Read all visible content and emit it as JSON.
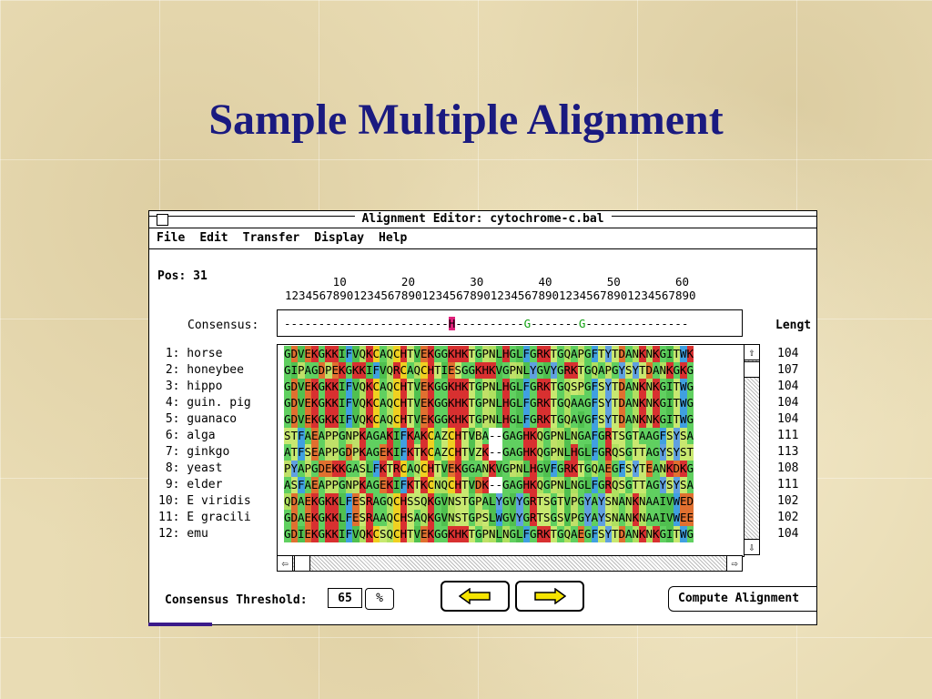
{
  "slide": {
    "title": "Sample Multiple Alignment"
  },
  "window": {
    "title": "Alignment Editor: cytochrome-c.bal",
    "menu": [
      "File",
      "Edit",
      "Transfer",
      "Display",
      "Help"
    ]
  },
  "position": {
    "label": "Pos: 31"
  },
  "ruler": {
    "tens": "       10        20        30        40        50        60",
    "digits": "123456789012345678901234567890123456789012345678901234567890"
  },
  "consensus": {
    "label": "Consensus:",
    "sequence": "------------------------H----------G-------G---------------"
  },
  "length_header": "Lengt",
  "sequences": [
    {
      "label": " 1: horse",
      "seq": "GDVEKGKKIFVQKCAQCHTVEKGGKHKTGPNLHGLFGRKTGQAPGFTYTDANKNKGITWK",
      "len": "104"
    },
    {
      "label": " 2: honeybee",
      "seq": "GIPAGDPEKGKKIFVQRCAQCHTIESGGKHKVGPNLYGVYGRKTGQAPGYSYTDANKGKG",
      "len": "107"
    },
    {
      "label": " 3: hippo",
      "seq": "GDVEKGKKIFVQKCAQCHTVEKGGKHKTGPNLHGLFGRKTGQSPGFSYTDANKNKGITWG",
      "len": "104"
    },
    {
      "label": " 4: guin. pig",
      "seq": "GDVEKGKKIFVQKCAQCHTVEKGGKHKTGPNLHGLFGRKTGQAAGFSYTDANKNKGITWG",
      "len": "104"
    },
    {
      "label": " 5: guanaco",
      "seq": "GDVEKGKKIFVQKCAQCHTVEKGGKHKTGPNLHGLFGRKTGQAVGFSYTDANKNKGITWG",
      "len": "104"
    },
    {
      "label": " 6: alga",
      "seq": "STFAEAPPGNPKAGAKIFKAKCAZCHTVBA--GAGHKQGPNLNGAFGRTSGTAAGFSYSA",
      "len": "111"
    },
    {
      "label": " 7: ginkgo",
      "seq": "ATFSEAPPGDPKAGEKIFKTKCAZCHTVZK--GAGHKQGPNLHGLFGRQSGTTAGYSYST",
      "len": "113"
    },
    {
      "label": " 8: yeast",
      "seq": "PYAPGDEKKGASLFKTRCAQCHTVEKGGANKVGPNLHGVFGRKTGQAEGFSYTEANKDKG",
      "len": "108"
    },
    {
      "label": " 9: elder",
      "seq": "ASFAEAPPGNPKAGEKIFKTKCNQCHTVDK--GAGHKQGPNLNGLFGRQSGTTAGYSYSA",
      "len": "111"
    },
    {
      "label": "10: E viridis",
      "seq": "QDAEKGKKLFESRAGQCHSSQKGVNSTGPALYGVYGRTSGTVPGYAYSNANKNAAIVWED",
      "len": "102"
    },
    {
      "label": "11: E gracili",
      "seq": "GDAEKGKKLFESRAAQCHSAQKGVNSTGPSLWGVYGRTSGSVPGYAYSNANKNAAIVWEE",
      "len": "102"
    },
    {
      "label": "12: emu",
      "seq": "GDIEKGKKIFVQKCSQCHTVEKGGKHKTGPNLNGLFGRKTGQAEGFSYTDANKNKGITWG",
      "len": "104"
    }
  ],
  "residue_colors": {
    "K": "#d83030",
    "R": "#d83030",
    "H": "#d83030",
    "D": "#e07030",
    "E": "#e07030",
    "C": "#f0d020",
    "A": "#60d060",
    "G": "#60d060",
    "V": "#50c050",
    "I": "#50c050",
    "L": "#50c050",
    "F": "#40a0e0",
    "Y": "#60a0e0",
    "W": "#40a0e0",
    "Q": "#b0e060",
    "N": "#b0e060",
    "S": "#c8e870",
    "T": "#c8e870",
    "P": "#c0e068",
    "M": "#60d060",
    "B": "#c8e870",
    "Z": "#c8e870",
    "-": "#ffffff"
  },
  "controls": {
    "threshold_label": "Consensus Threshold:",
    "threshold_value": "65",
    "percent_label": "%",
    "compute_label": "Compute Alignment"
  }
}
